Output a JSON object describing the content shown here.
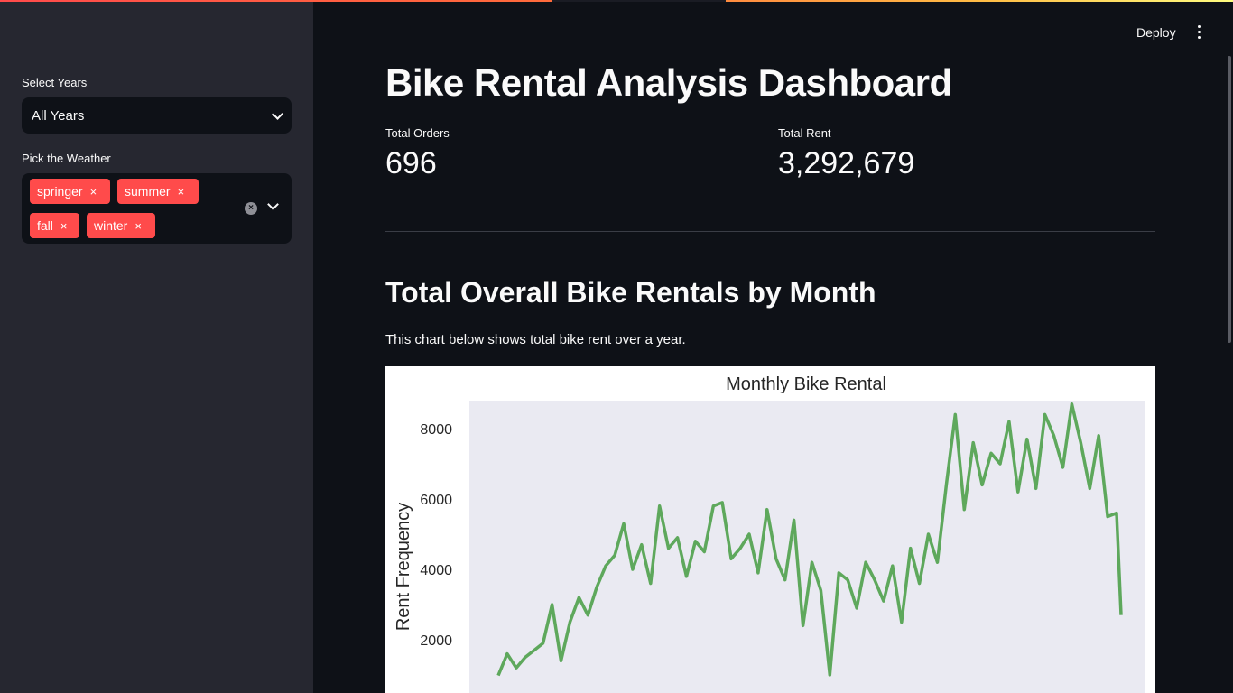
{
  "sidebar": {
    "years_label": "Select Years",
    "years_value": "All Years",
    "weather_label": "Pick the Weather",
    "weather_tags": [
      "springer",
      "summer",
      "fall",
      "winter"
    ],
    "tag_remove_glyph": "×",
    "clear_glyph": "×"
  },
  "header": {
    "deploy_label": "Deploy"
  },
  "main": {
    "title": "Bike Rental Analysis Dashboard",
    "metrics": [
      {
        "label": "Total Orders",
        "value": "696"
      },
      {
        "label": "Total Rent",
        "value": "3,292,679"
      }
    ],
    "section_title": "Total Overall Bike Rentals by Month",
    "caption": "This chart below shows total bike rent over a year."
  },
  "colors": {
    "accent": "#ff4b4b",
    "line": "#5ea85c",
    "plot_bg": "#eaeaf2"
  },
  "chart_data": {
    "type": "line",
    "title": "Monthly Bike Rental",
    "xlabel": "",
    "ylabel": "Rent Frequency",
    "yticks": [
      2000,
      4000,
      6000,
      8000
    ],
    "ylim": [
      0,
      9200
    ],
    "grid": false,
    "x": [
      0,
      10,
      20,
      30,
      40,
      50,
      60,
      70,
      80,
      90,
      100,
      110,
      120,
      130,
      140,
      150,
      160,
      170,
      180,
      190,
      200,
      210,
      220,
      230,
      240,
      250,
      260,
      270,
      280,
      290,
      300,
      310,
      320,
      330,
      340,
      350,
      360,
      370,
      380,
      390,
      400,
      410,
      420,
      430,
      440,
      450,
      460,
      470,
      480,
      490,
      500,
      510,
      520,
      530,
      540,
      550,
      560,
      570,
      580,
      590,
      600,
      610,
      620,
      630,
      640,
      650,
      660,
      670,
      680,
      690,
      695
    ],
    "series": [
      {
        "values": [
          985,
          1600,
          1200,
          1500,
          1700,
          1900,
          3000,
          1400,
          2500,
          3200,
          2700,
          3500,
          4100,
          4400,
          5300,
          4000,
          4700,
          3600,
          5800,
          4600,
          4900,
          3800,
          4800,
          4500,
          5800,
          5900,
          4300,
          4600,
          5000,
          3900,
          5700,
          4300,
          3700,
          5400,
          2400,
          4200,
          3400,
          1000,
          3900,
          3700,
          2900,
          4200,
          3700,
          3100,
          4100,
          2500,
          4600,
          3600,
          5000,
          4200,
          6400,
          8400,
          5700,
          7600,
          6400,
          7300,
          7000,
          8200,
          6200,
          7700,
          6300,
          8400,
          7800,
          6900,
          8700,
          7600,
          6300,
          7800,
          5500,
          5600,
          2700
        ]
      }
    ]
  }
}
